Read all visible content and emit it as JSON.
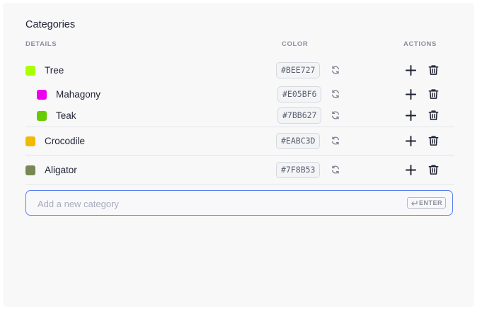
{
  "title": "Categories",
  "columns": {
    "details": "DETAILS",
    "color": "COLOR",
    "actions": "ACTIONS"
  },
  "categories": [
    {
      "name": "Tree",
      "hex": "#BEE727",
      "level": 0
    },
    {
      "name": "Mahagony",
      "hex": "#E05BF6",
      "level": 1
    },
    {
      "name": "Teak",
      "hex": "#7BB627",
      "level": 1
    },
    {
      "name": "Crocodile",
      "hex": "#EABC3D",
      "level": 0
    },
    {
      "name": "Aligator",
      "hex": "#7F8B53",
      "level": 0
    }
  ],
  "swatch_colors": {
    "Tree": "#aaff00",
    "Mahagony": "#ee00ee",
    "Teak": "#66cc00",
    "Crocodile": "#eebb00",
    "Aligator": "#778855"
  },
  "new_category": {
    "placeholder": "Add a new category",
    "enter_label": "ENTER"
  },
  "icons": {
    "refresh": "refresh-icon",
    "add": "plus-icon",
    "delete": "trash-icon",
    "enter": "return-icon"
  }
}
